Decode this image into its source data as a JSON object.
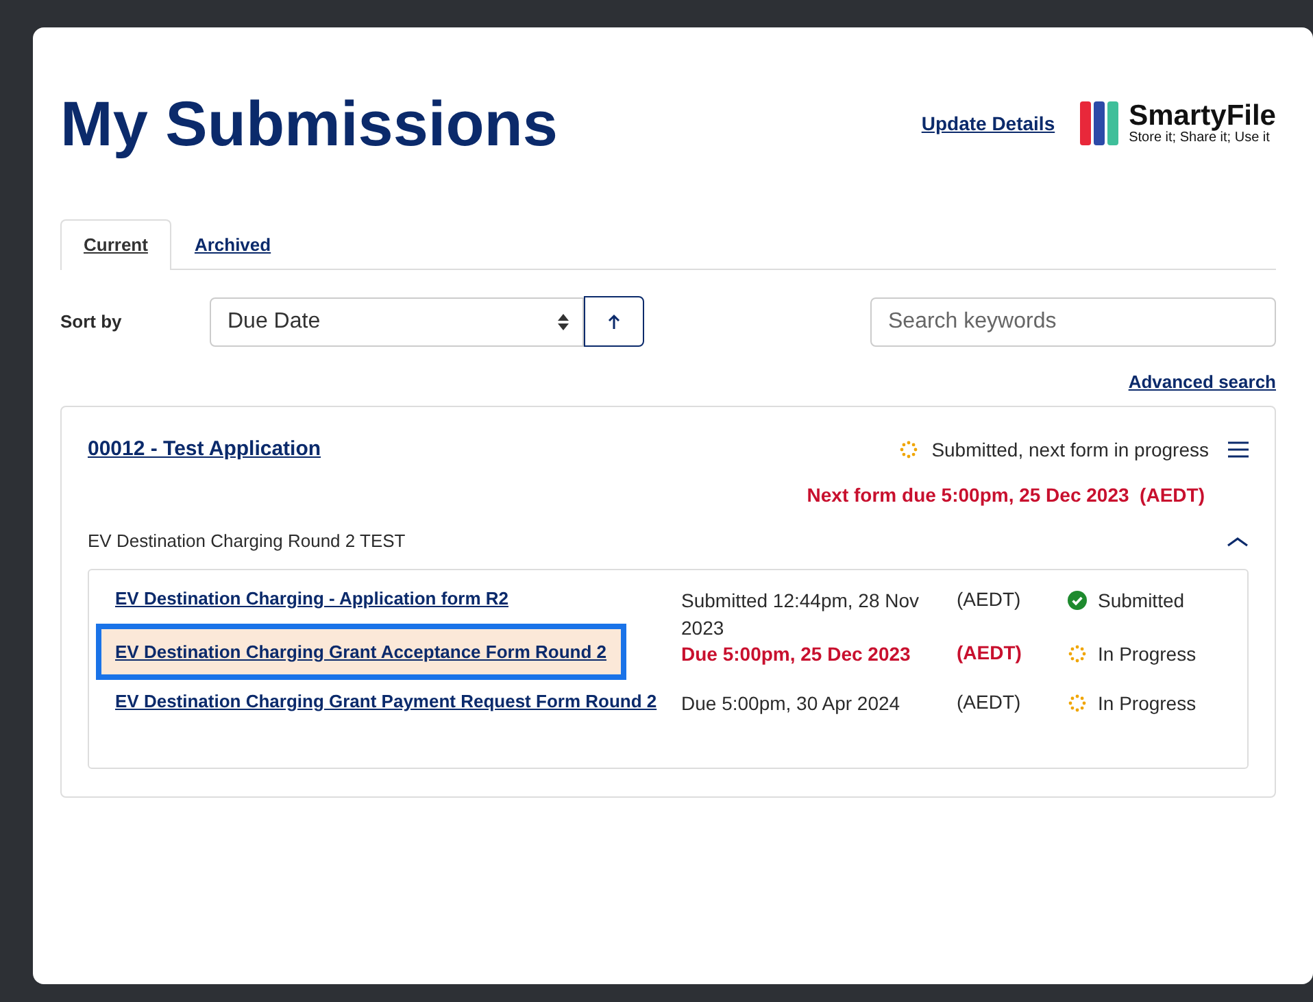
{
  "page": {
    "title": "My Submissions",
    "update_link": "Update Details",
    "logo": {
      "name": "SmartyFile",
      "tagline": "Store it; Share it; Use it"
    }
  },
  "tabs": [
    {
      "label": "Current",
      "selected": true
    },
    {
      "label": "Archived",
      "selected": false
    }
  ],
  "sort": {
    "label": "Sort by",
    "value": "Due Date",
    "ascending": true
  },
  "search": {
    "placeholder": "Search keywords",
    "advanced_link": "Advanced search"
  },
  "application": {
    "title": "00012 - Test Application",
    "status": {
      "text": "Submitted, next form in progress",
      "kind": "in_progress"
    },
    "next_due": "Next form due 5:00pm, 25 Dec 2023  (AEDT)",
    "program": "EV Destination Charging Round 2 TEST",
    "expanded": true,
    "forms": [
      {
        "title": "EV Destination Charging - Application form R2",
        "date": "Submitted 12:44pm, 28 Nov 2023",
        "timezone": "(AEDT)",
        "status": {
          "text": "Submitted",
          "kind": "submitted"
        },
        "overdue": false,
        "highlighted": false
      },
      {
        "title": "EV Destination Charging Grant Acceptance Form Round 2",
        "date": "Due 5:00pm, 25 Dec 2023",
        "timezone": "(AEDT)",
        "status": {
          "text": "In Progress",
          "kind": "in_progress"
        },
        "overdue": true,
        "highlighted": true
      },
      {
        "title": "EV Destination Charging Grant Payment Request Form Round 2",
        "date": "Due 5:00pm, 30 Apr 2024",
        "timezone": "(AEDT)",
        "status": {
          "text": "In Progress",
          "kind": "in_progress"
        },
        "overdue": false,
        "highlighted": false
      }
    ]
  }
}
